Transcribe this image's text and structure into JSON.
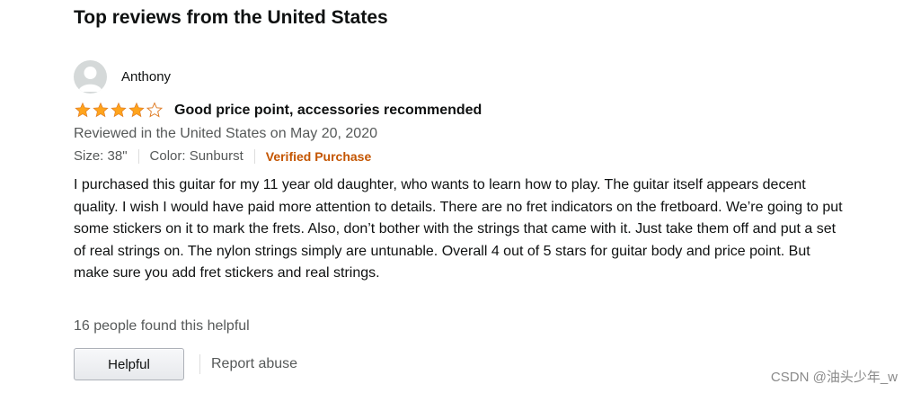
{
  "section": {
    "title": "Top reviews from the United States"
  },
  "review": {
    "reviewer": {
      "name": "Anthony",
      "avatar_icon": "user-avatar-icon"
    },
    "rating": {
      "stars_filled": 4,
      "stars_total": 5,
      "star_color": "#ffa41c"
    },
    "title": "Good price point, accessories recommended",
    "date_line": "Reviewed in the United States on May 20, 2020",
    "variant": {
      "size": "Size: 38\"",
      "color": "Color: Sunburst",
      "verified": "Verified Purchase",
      "verified_color": "#c45500"
    },
    "body": "I purchased this guitar for my 11 year old daughter, who wants to learn how to play. The guitar itself appears decent quality. I wish I would have paid more attention to details. There are no fret indicators on the fretboard. We’re going to put some stickers on it to mark the frets. Also, don’t bother with the strings that came with it. Just take them off and put a set of real strings on. The nylon strings simply are untunable. Overall 4 out of 5 stars for guitar body and price point. But make sure you add fret stickers and real strings.",
    "helpful_count": "16 people found this helpful",
    "actions": {
      "helpful_label": "Helpful",
      "report_label": "Report abuse"
    }
  },
  "watermark": "CSDN @油头少年_w"
}
